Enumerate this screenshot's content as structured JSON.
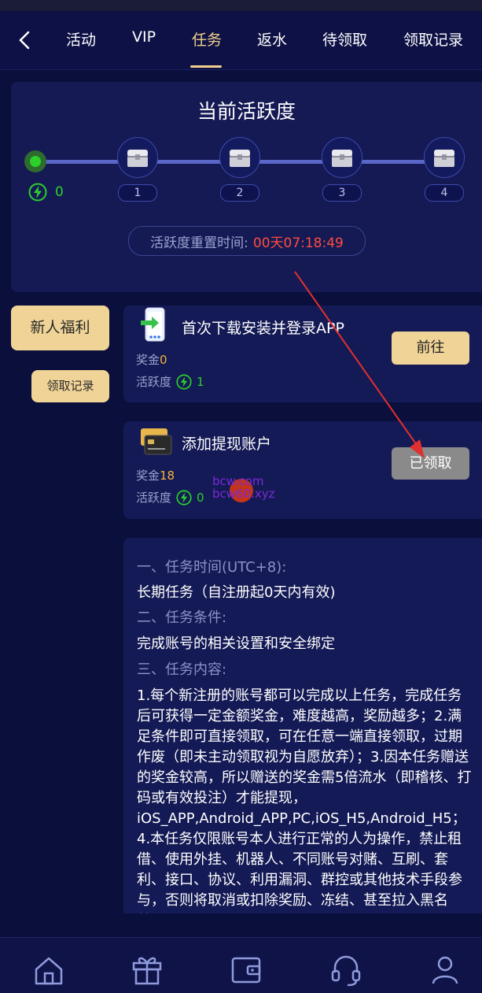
{
  "nav": {
    "tabs": [
      {
        "label": "活动"
      },
      {
        "label": "VIP"
      },
      {
        "label": "任务",
        "active": true
      },
      {
        "label": "返水"
      },
      {
        "label": "待领取"
      },
      {
        "label": "领取记录"
      }
    ]
  },
  "activity": {
    "title": "当前活跃度",
    "current": "0",
    "levels": [
      "1",
      "2",
      "3",
      "4"
    ],
    "reset_label": "活跃度重置时间:",
    "countdown": "00天07:18:49"
  },
  "sidebar": {
    "newbie_label": "新人福利",
    "records_label": "领取记录"
  },
  "tasks": [
    {
      "title": "首次下载安装并登录APP",
      "reward_label": "奖金",
      "reward_value": "0",
      "activity_label": "活跃度",
      "activity_value": "1",
      "button_label": "前往"
    },
    {
      "title": "添加提现账户",
      "reward_label": "奖金",
      "reward_value": "18",
      "activity_label": "活跃度",
      "activity_value": "0",
      "button_label": "已领取"
    }
  ],
  "watermark": {
    "line1": "bcw.com",
    "line2": "bcw60.xyz"
  },
  "rules": [
    {
      "type": "h",
      "text": "一、任务时间(UTC+8):"
    },
    {
      "type": "t",
      "text": "长期任务（自注册起0天内有效)"
    },
    {
      "type": "h",
      "text": "二、任务条件:"
    },
    {
      "type": "t",
      "text": "完成账号的相关设置和安全绑定"
    },
    {
      "type": "h",
      "text": "三、任务内容:"
    },
    {
      "type": "t",
      "text": "1.每个新注册的账号都可以完成以上任务，完成任务后可获得一定金额奖金，难度越高，奖励越多；2.满足条件即可直接领取，可在任意一端直接领取，过期作废（即未主动领取视为自愿放弃）；3.因本任务赠送的奖金较高，所以赠送的奖金需5倍流水（即稽核、打码或有效投注）才能提现，iOS_APP,Android_APP,PC,iOS_H5,Android_H5；4.本任务仅限账号本人进行正常的人为操作，禁止租借、使用外挂、机器人、不同账号对赌、互刷、套利、接口、协议、利用漏洞、群控或其他技术手段参与，否则将取消或扣除奖励、冻结、甚至拉入黑名单；"
    }
  ],
  "bottom_nav": [
    {
      "icon": "home-icon"
    },
    {
      "icon": "gift-icon"
    },
    {
      "icon": "wallet-icon"
    },
    {
      "icon": "headset-icon"
    },
    {
      "icon": "user-icon"
    }
  ],
  "colors": {
    "background": "#0b0f3c",
    "card": "#141a55",
    "accent_gold": "#f2d08c",
    "active_green": "#2bd02b",
    "countdown_red": "#ff4d3d",
    "reward_orange": "#f5b23b"
  }
}
